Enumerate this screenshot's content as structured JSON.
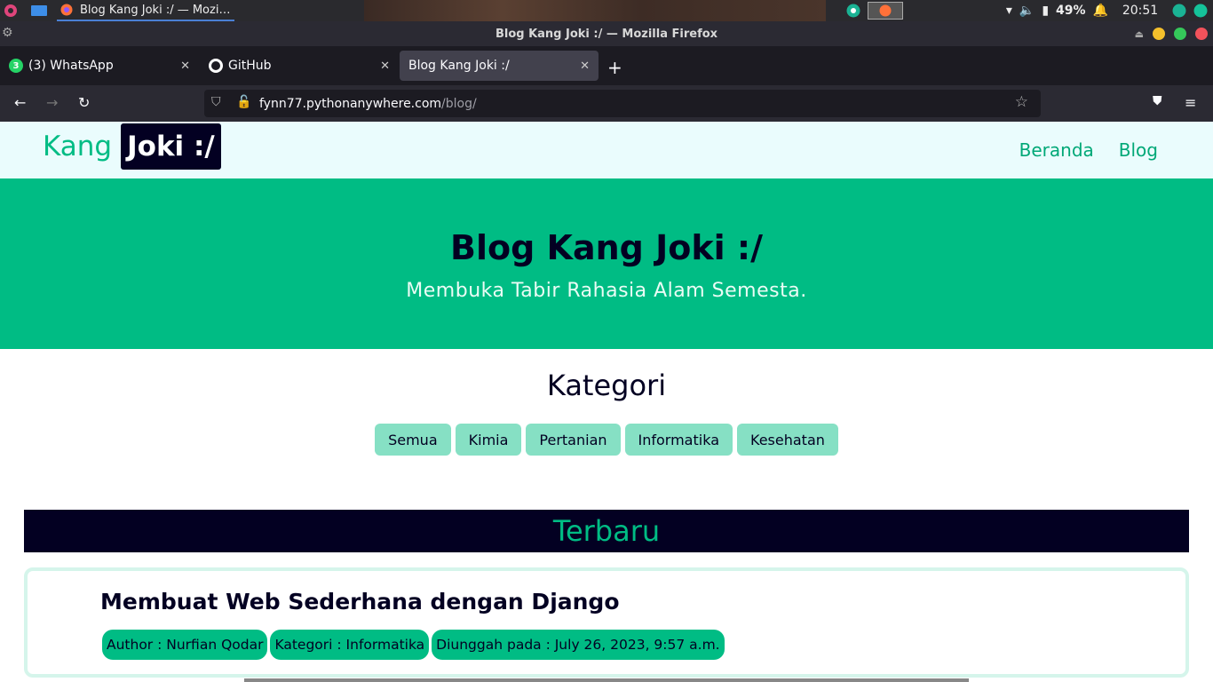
{
  "taskbar": {
    "task_title": "Blog Kang Joki :/ — Mozi…",
    "battery": "49%",
    "clock": "20:51"
  },
  "window": {
    "title": "Blog Kang Joki :/ — Mozilla Firefox"
  },
  "tabs": [
    {
      "label": "(3) WhatsApp",
      "badge": "3"
    },
    {
      "label": "GitHub"
    },
    {
      "label": "Blog Kang Joki :/"
    }
  ],
  "url": {
    "host": "fynn77.pythonanywhere.com",
    "path": "/blog/"
  },
  "site": {
    "brand_a": "Kang",
    "brand_b": "Joki :/",
    "nav": [
      "Beranda",
      "Blog"
    ],
    "hero_title": "Blog Kang Joki :/",
    "hero_subtitle": "Membuka Tabir Rahasia Alam Semesta.",
    "kategori_title": "Kategori",
    "categories": [
      "Semua",
      "Kimia",
      "Pertanian",
      "Informatika",
      "Kesehatan"
    ],
    "terbaru": "Terbaru",
    "post": {
      "title": "Membuat Web Sederhana dengan Django",
      "author": "Author : Nurfian Qodar",
      "category": "Kategori : Informatika",
      "date": "Diunggah pada : July 26, 2023, 9:57 a.m."
    }
  },
  "colors": {
    "accent": "#00bc84",
    "dark": "#030022",
    "chip": "#86e0c4"
  }
}
